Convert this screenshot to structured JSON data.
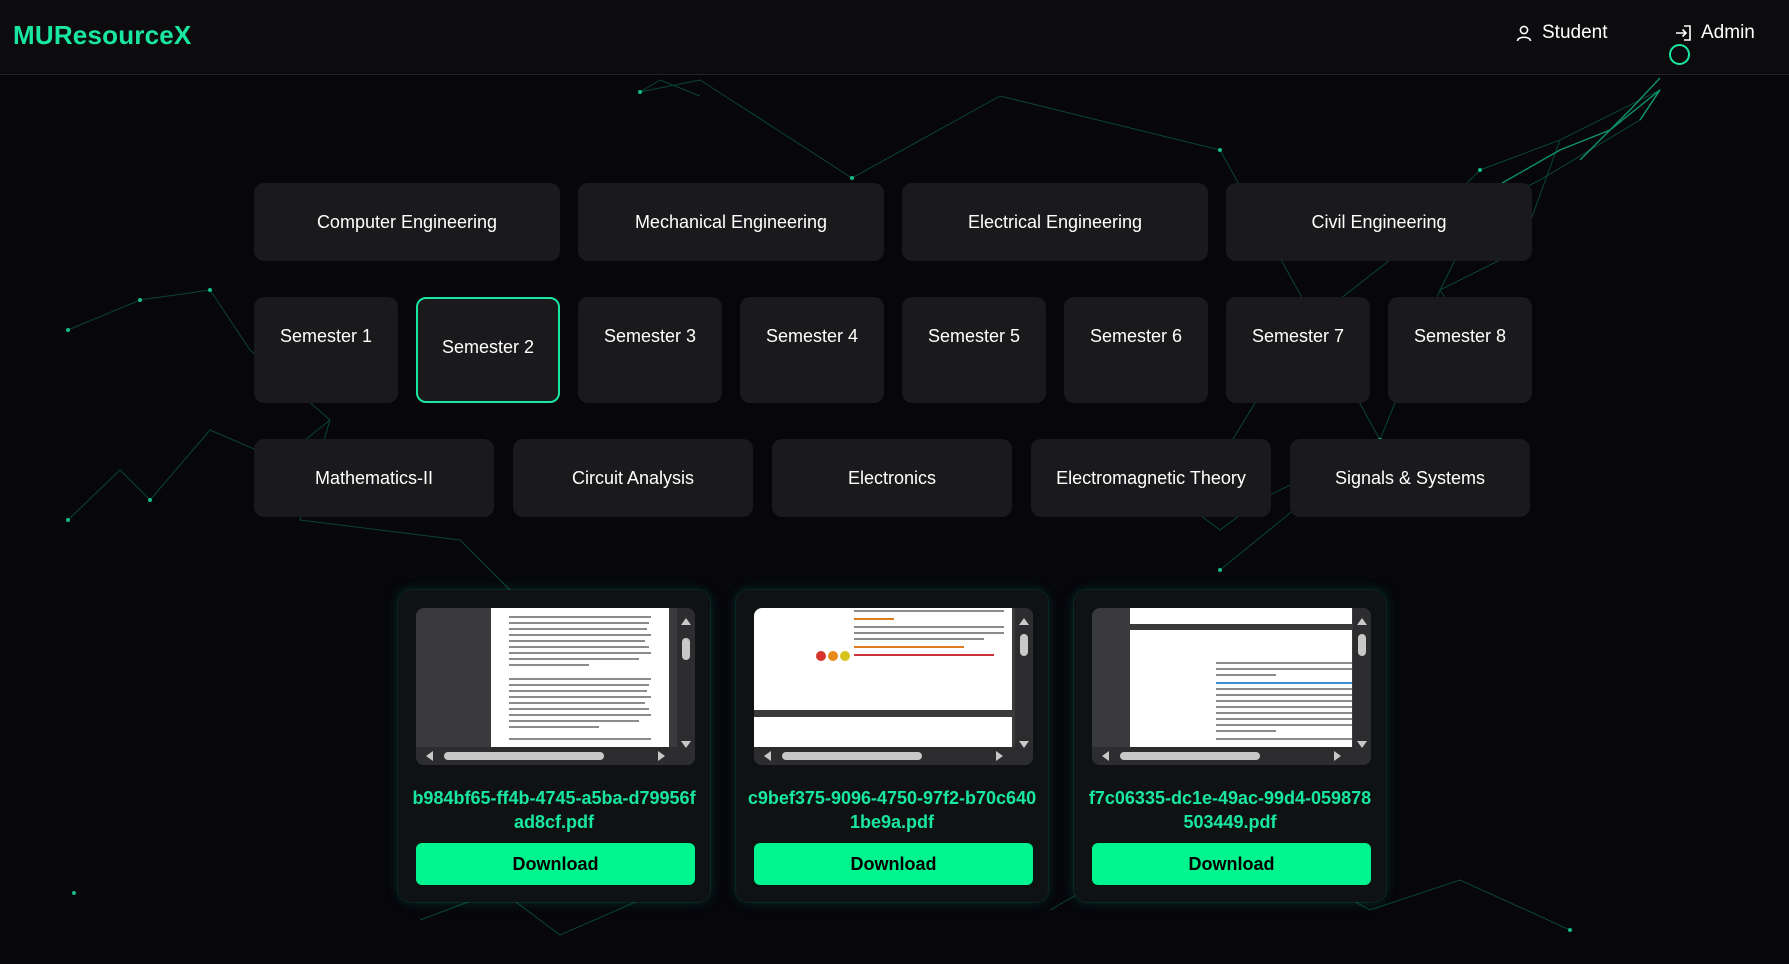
{
  "app": {
    "brand": "MUResourceX"
  },
  "nav": {
    "student_label": "Student",
    "admin_label": "Admin"
  },
  "branches": [
    "Computer Engineering",
    "Mechanical Engineering",
    "Electrical Engineering",
    "Civil Engineering"
  ],
  "semesters": [
    "Semester 1",
    "Semester 2",
    "Semester 3",
    "Semester 4",
    "Semester 5",
    "Semester 6",
    "Semester 7",
    "Semester 8"
  ],
  "selected_semester": "Semester 2",
  "subjects": [
    "Mathematics-II",
    "Circuit Analysis",
    "Electronics",
    "Electromagnetic Theory",
    "Signals & Systems"
  ],
  "files": [
    {
      "name": "b984bf65-ff4b-4745-a5ba-d79956fad8cf.pdf",
      "download_label": "Download"
    },
    {
      "name": "c9bef375-9096-4750-97f2-b70c6401be9a.pdf",
      "download_label": "Download"
    },
    {
      "name": "f7c06335-dc1e-49ac-99d4-059878503449.pdf",
      "download_label": "Download"
    }
  ],
  "colors": {
    "accent": "#19e6a0",
    "button": "#00f58e",
    "background": "#06060b",
    "tile": "#1a1a1c"
  }
}
